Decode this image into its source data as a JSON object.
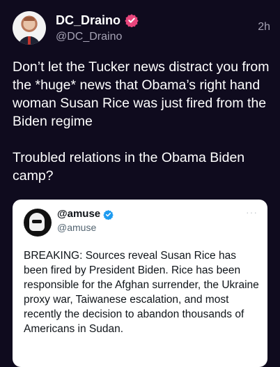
{
  "post": {
    "author": {
      "display_name": "DC_Draino",
      "handle": "@DC_Draino",
      "verified": true,
      "verified_color": "#e8457c"
    },
    "timestamp": "2h",
    "text": "Don’t let the Tucker news distract you from the *huge* news that Obama’s right hand woman Susan Rice was just fired from the Biden regime\n\nTroubled relations in the Obama Biden camp?"
  },
  "quoted_post": {
    "author": {
      "display_name": "@amuse",
      "handle": "@amuse",
      "verified": true,
      "verified_color": "#1d9bf0"
    },
    "more_icon": "···",
    "text": "BREAKING: Sources reveal Susan Rice has been fired by President Biden. Rice has been responsible for the Afghan surrender, the Ukraine proxy war, Taiwanese escalation, and most recently the decision to abandon thousands of Americans in Sudan."
  },
  "colors": {
    "background": "#0f0b1e",
    "secondary_text": "#a6a3b5",
    "card_background": "#ffffff"
  }
}
